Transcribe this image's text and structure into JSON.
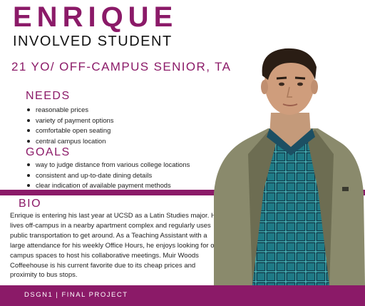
{
  "persona": {
    "name": "ENRIQUE",
    "role": "INVOLVED STUDENT",
    "tagline": "21 YO/ OFF-CAMPUS SENIOR, TA"
  },
  "needs": {
    "heading": "NEEDS",
    "items": [
      "reasonable prices",
      "variety of payment options",
      "comfortable open seating",
      "central campus location"
    ]
  },
  "goals": {
    "heading": "GOALS",
    "items": [
      "way to judge distance from various college locations",
      "consistent and up-to-date dining details",
      "clear indication of  available payment methods"
    ]
  },
  "bio": {
    "heading": "BIO",
    "text": "Enrique is entering his last year at UCSD as a Latin Studies major. He lives off-campus in a nearby apartment complex and regularly uses public transportation to get around. As a Teaching Assistant with a large attendance for his weekly Office Hours, he enjoys looking for on-campus spaces to host his collaborative meetings. Muir Woods Coffeehouse is his current favorite due to its cheap prices and proximity to bus stops."
  },
  "footer": {
    "text": "DSGN1 | FINAL PROJECT"
  },
  "colors": {
    "accent": "#8b1a68",
    "text": "#222222",
    "background": "#ffffff"
  }
}
